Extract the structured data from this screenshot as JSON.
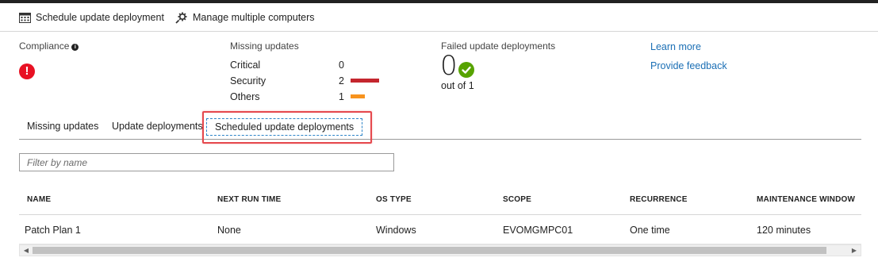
{
  "toolbar": {
    "schedule_label": "Schedule update deployment",
    "manage_label": "Manage multiple computers"
  },
  "summary": {
    "compliance_label": "Compliance",
    "missing_updates": {
      "label": "Missing updates",
      "rows": [
        {
          "name": "Critical",
          "count": "0",
          "color": ""
        },
        {
          "name": "Security",
          "count": "2",
          "color": "#c4262e"
        },
        {
          "name": "Others",
          "count": "1",
          "color": "#f7931e"
        }
      ]
    },
    "failed": {
      "label": "Failed update deployments",
      "value": "0",
      "out_of": "out of 1"
    },
    "links": {
      "learn_more": "Learn more",
      "provide_feedback": "Provide feedback"
    }
  },
  "tabs": [
    {
      "label": "Missing updates"
    },
    {
      "label": "Update deployments"
    },
    {
      "label": "Scheduled update deployments",
      "active": true
    }
  ],
  "filter": {
    "placeholder": "Filter by name"
  },
  "table": {
    "columns": [
      "NAME",
      "NEXT RUN TIME",
      "OS TYPE",
      "SCOPE",
      "RECURRENCE",
      "MAINTENANCE WINDOW"
    ],
    "rows": [
      [
        "Patch Plan 1",
        "None",
        "Windows",
        "EVOMGMPC01",
        "One time",
        "120 minutes"
      ]
    ]
  },
  "icons": {
    "calendar": "calendar-icon",
    "gear": "gear-icon",
    "info": "info-icon",
    "error": "error-icon",
    "success": "success-check-icon"
  },
  "colors": {
    "link": "#1b6fb5",
    "error": "#e81123",
    "success": "#57a300",
    "highlight": "#e5484d"
  }
}
